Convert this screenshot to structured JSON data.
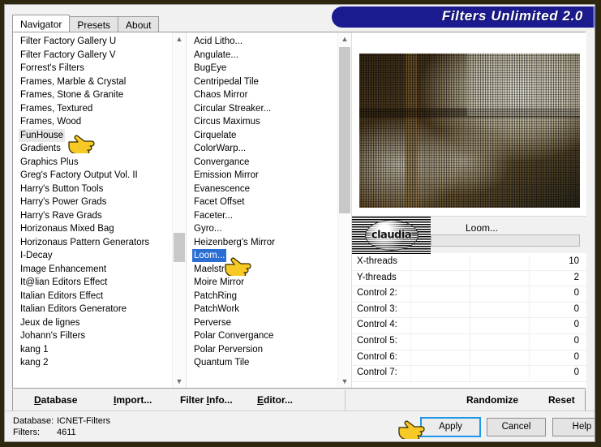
{
  "window": {
    "title": "Filters Unlimited 2.0"
  },
  "tabs": [
    {
      "label": "Navigator",
      "active": true
    },
    {
      "label": "Presets",
      "active": false
    },
    {
      "label": "About",
      "active": false
    }
  ],
  "categories": {
    "selected": "FunHouse",
    "items": [
      "Filter Factory Gallery U",
      "Filter Factory Gallery V",
      "Forrest's Filters",
      "Frames, Marble & Crystal",
      "Frames, Stone & Granite",
      "Frames, Textured",
      "Frames, Wood",
      "FunHouse",
      "Gradients",
      "Graphics Plus",
      "Greg's Factory Output Vol. II",
      "Harry's Button Tools",
      "Harry's Power Grads",
      "Harry's Rave Grads",
      "Horizonaus Mixed Bag",
      "Horizonaus Pattern Generators",
      "I-Decay",
      "Image Enhancement",
      "It@lian Editors Effect",
      "Italian Editors Effect",
      "Italian Editors Generatore",
      "Jeux de lignes",
      "Johann's Filters",
      "kang 1",
      "kang 2"
    ]
  },
  "filters": {
    "selected": "Loom...",
    "items": [
      "Acid Litho...",
      "Angulate...",
      "BugEye",
      "Centripedal Tile",
      "Chaos Mirror",
      "Circular Streaker...",
      "Circus Maximus",
      "Cirquelate",
      "ColorWarp...",
      "Convergance",
      "Emission Mirror",
      "Evanescence",
      "Facet Offset",
      "Faceter...",
      "Gyro...",
      "Heizenberg's Mirror",
      "Loom...",
      "Maelström",
      "Moire Mirror",
      "PatchRing",
      "PatchWork",
      "Perverse",
      "Polar Convergance",
      "Polar Perversion",
      "Quantum Tile"
    ]
  },
  "preview": {
    "logo_text": "claudia",
    "filter_name": "Loom..."
  },
  "parameters": [
    {
      "label": "X-threads",
      "value": "10"
    },
    {
      "label": "Y-threads",
      "value": "2"
    },
    {
      "label": "Control 2:",
      "value": "0"
    },
    {
      "label": "Control 3:",
      "value": "0"
    },
    {
      "label": "Control 4:",
      "value": "0"
    },
    {
      "label": "Control 5:",
      "value": "0"
    },
    {
      "label": "Control 6:",
      "value": "0"
    },
    {
      "label": "Control 7:",
      "value": "0"
    }
  ],
  "toolbar": {
    "database": "Database",
    "import": "Import...",
    "filter_info": "Filter Info...",
    "editor": "Editor...",
    "randomize": "Randomize",
    "reset": "Reset"
  },
  "status": {
    "database_label": "Database:",
    "database_value": "ICNET-Filters",
    "filters_label": "Filters:",
    "filters_value": "4611"
  },
  "buttons": {
    "apply": "Apply",
    "cancel": "Cancel",
    "help": "Help"
  },
  "colors": {
    "title_banner": "#1b1b8f",
    "selection_blue": "#2a6ed4",
    "selection_gray": "#e8e8e8",
    "focus_outline": "#1d97e8",
    "window_border": "#2e2710"
  }
}
